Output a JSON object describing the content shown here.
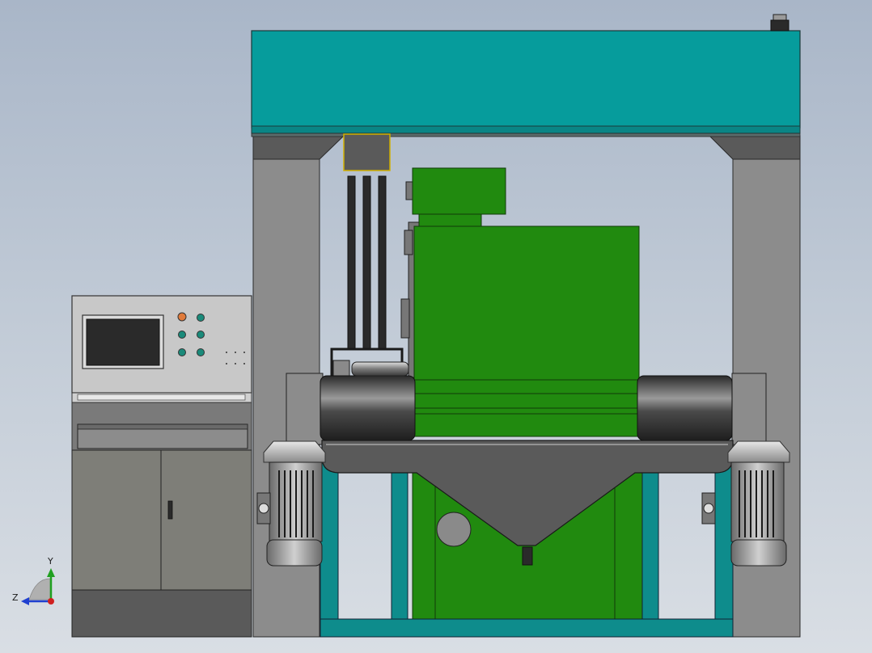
{
  "colors": {
    "background_top": "#a9b6c8",
    "background_bottom": "#d9dee4",
    "beam_teal": "#069c9c",
    "frame_teal": "#0e8c8c",
    "column_grey": "#8a8a8a",
    "machine_green": "#218a0f",
    "drum_dark": "#3a3a3a",
    "hopper_grey": "#5a5a5a",
    "cabinet_grey": "#8c8c8c",
    "screen_black": "#2a2a2a",
    "button_orange": "#e07a3a",
    "button_teal": "#1a8a7a",
    "axis_x": "#d02020",
    "axis_y": "#20a020",
    "axis_z": "#2040d0"
  },
  "axis_triad": {
    "y_label": "Y",
    "z_label": "Z"
  },
  "components": {
    "top_beam": "top-beam",
    "left_column": "left-column",
    "right_column": "right-column",
    "green_machine": "green-machine",
    "left_drum": "left-drum",
    "right_drum": "right-drum",
    "hopper": "hopper",
    "left_motor": "left-motor",
    "right_motor": "right-motor",
    "control_cabinet": "control-cabinet",
    "hmi_screen": "hmi-screen",
    "base_frame": "base-frame"
  }
}
